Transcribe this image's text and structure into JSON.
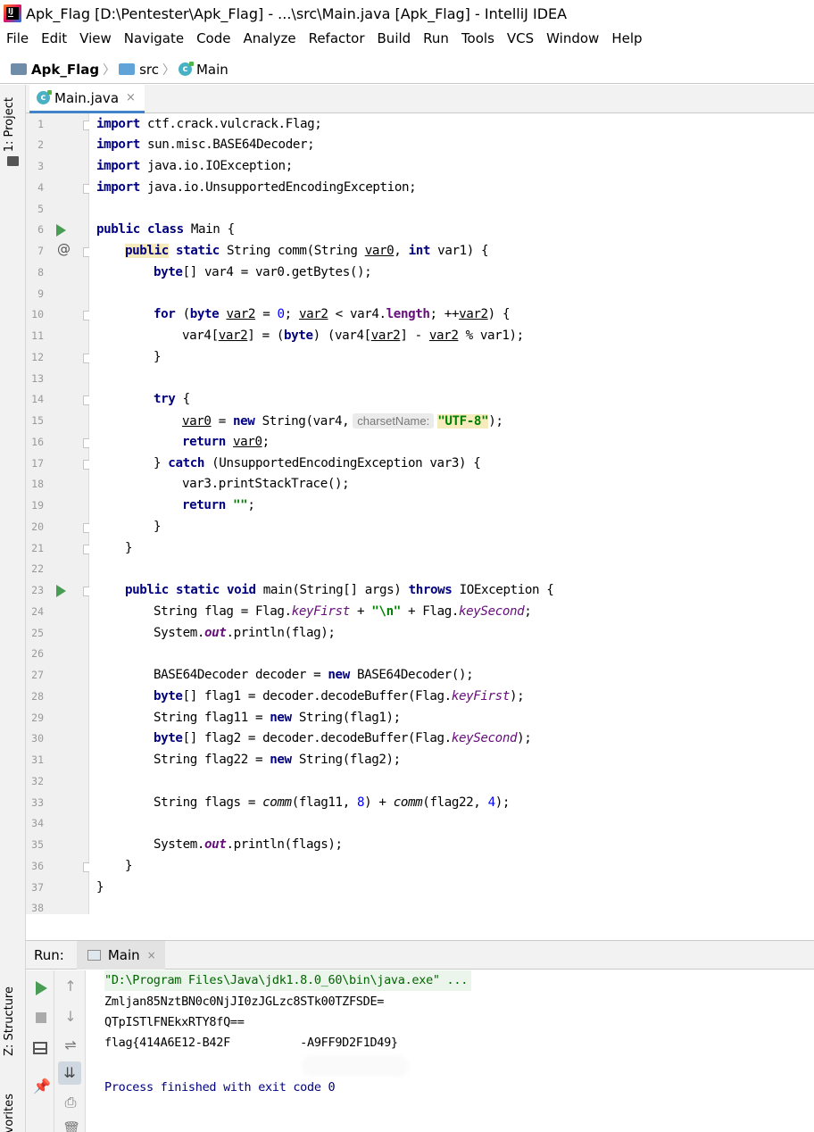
{
  "window": {
    "title": "Apk_Flag [D:\\Pentester\\Apk_Flag] - ...\\src\\Main.java [Apk_Flag] - IntelliJ IDEA",
    "app_icon": "intellij-idea-logo"
  },
  "menu": [
    "File",
    "Edit",
    "View",
    "Navigate",
    "Code",
    "Analyze",
    "Refactor",
    "Build",
    "Run",
    "Tools",
    "VCS",
    "Window",
    "Help"
  ],
  "breadcrumb": {
    "project": "Apk_Flag",
    "folder": "src",
    "file": "Main"
  },
  "side_tabs": {
    "project": "1: Project",
    "structure": "Z: Structure",
    "favorites": "Favorites"
  },
  "editor": {
    "tab": {
      "label": "Main.java",
      "close": "×"
    },
    "line_numbers": [
      "1",
      "2",
      "3",
      "4",
      "5",
      "6",
      "7",
      "8",
      "9",
      "10",
      "11",
      "12",
      "13",
      "14",
      "15",
      "16",
      "17",
      "18",
      "19",
      "20",
      "21",
      "22",
      "23",
      "24",
      "25",
      "26",
      "27",
      "28",
      "29",
      "30",
      "31",
      "32",
      "33",
      "34",
      "35",
      "36",
      "37",
      "38"
    ],
    "current_line": 5,
    "parameter_hint": "charsetName:",
    "code": {
      "import_kw": "import",
      "l1_rest": " ctf.crack.vulcrack.Flag;",
      "l2_rest": " sun.misc.BASE64Decoder;",
      "l3_rest": " java.io.IOException;",
      "l4_rest": " java.io.UnsupportedEncodingException;",
      "public": "public",
      "class": "class",
      "static": "static",
      "int": "int",
      "byte": "byte",
      "for": "for",
      "try": "try",
      "new": "new",
      "return": "return",
      "catch": "catch",
      "void": "void",
      "throws": "throws",
      "main_class": " Main {",
      "l7_a": " String comm(String ",
      "var0": "var0",
      "l7_b": ", ",
      "l7_c": " var1) {",
      "l8_a": "[] var4 = var0.getBytes();",
      "l10_a": " (",
      "var2": "var2",
      "l10_b": " = ",
      "zero": "0",
      "l10_c": "; ",
      "l10_d": " < var4.",
      "length": "length",
      "l10_e": "; ++",
      "l10_f": ") {",
      "l11_a": "var4[",
      "l11_b": "] = (",
      "l11_c": ") (var4[",
      "l11_d": "] - ",
      "l11_e": " % var1);",
      "brace_close": "}",
      "l14_a": " {",
      "l15_a": " = ",
      "l15_b": " String(var4,",
      "utf8": "\"UTF-8\"",
      "l15_c": ");",
      "l16_a": " ",
      "l16_b": ";",
      "l17_a": "} ",
      "l17_b": " (UnsupportedEncodingException var3) {",
      "l18": "var3.printStackTrace();",
      "empty_str": "\"\"",
      "semi": ";",
      "l23_a": " main(String[] args) ",
      "l23_b": " IOException {",
      "l24_a": "String flag = Flag.",
      "keyFirst": "keyFirst",
      "l24_b": " + ",
      "newline_str": "\"\\n\"",
      "l24_c": " + Flag.",
      "keySecond": "keySecond",
      "l24_d": ";",
      "l25_a": "System.",
      "out": "out",
      "l25_b": ".println(flag);",
      "l27_a": "BASE64Decoder decoder = ",
      "l27_b": " BASE64Decoder();",
      "l28_a": "[] flag1 = decoder.decodeBuffer(Flag.",
      "l28_b": ");",
      "l29_a": "String flag11 = ",
      "l29_b": " String(flag1);",
      "l30_a": "[] flag2 = decoder.decodeBuffer(Flag.",
      "l30_b": ");",
      "l31_a": "String flag22 = ",
      "l31_b": " String(flag2);",
      "l33_a": "String flags = ",
      "comm": "comm",
      "l33_b": "(flag11, ",
      "eight": "8",
      "l33_c": ") + ",
      "l33_d": "(flag22, ",
      "four": "4",
      "l33_e": ");",
      "l35_b": ".println(flags);"
    }
  },
  "run": {
    "label": "Run:",
    "tab": "Main",
    "tab_close": "×",
    "console": {
      "command": "\"D:\\Program Files\\Java\\jdk1.8.0_60\\bin\\java.exe\" ...",
      "out1": "Zmljan85NztBN0c0NjJI0zJGLzc8STk00TZFSDE=",
      "out2": "QTpISTlFNEkxRTY8fQ==",
      "out3": "flag{414A6E12-B42F          -A9FF9D2F1D49}",
      "exit": "Process finished with exit code 0"
    },
    "buttons": {
      "up": "↑",
      "down": "↓",
      "wrap": "⇌",
      "scroll_end": "⇊",
      "print": "⎙",
      "trash": "🗑",
      "pin": "📌"
    }
  },
  "colors": {
    "keyword": "#000080",
    "string": "#008000",
    "number": "#0000ff",
    "field": "#660e7a",
    "run_green": "#499c54",
    "line_highlight": "#fffae3"
  }
}
